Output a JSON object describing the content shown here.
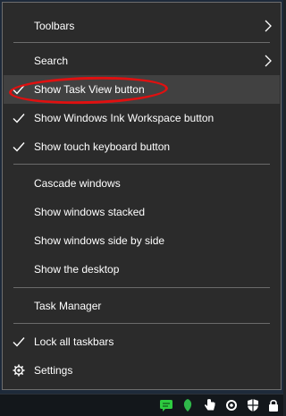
{
  "menu": {
    "toolbars": "Toolbars",
    "search": "Search",
    "show_task_view": "Show Task View button",
    "show_ink_workspace": "Show Windows Ink Workspace button",
    "show_touch_keyboard": "Show touch keyboard button",
    "cascade": "Cascade windows",
    "stacked": "Show windows stacked",
    "side_by_side": "Show windows side by side",
    "desktop": "Show the desktop",
    "task_manager": "Task Manager",
    "lock_taskbars": "Lock all taskbars",
    "settings": "Settings"
  },
  "checked_items": [
    "show_task_view",
    "show_ink_workspace",
    "show_touch_keyboard",
    "lock_taskbars"
  ],
  "highlighted_item": "show_task_view",
  "tray_icons": [
    "chat-icon",
    "leaf-icon",
    "hand-pointer-icon",
    "gear-icon",
    "shield-icon",
    "lock-icon"
  ],
  "colors": {
    "menu_bg": "#2b2b2b",
    "hover_bg": "#414141",
    "callout": "#e01010",
    "text": "#ffffff"
  }
}
